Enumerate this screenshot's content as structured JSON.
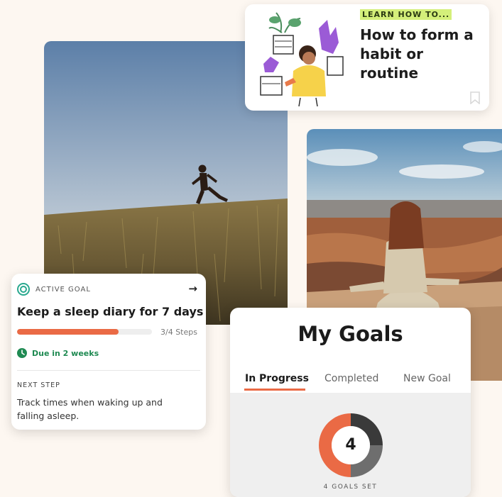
{
  "learn_card": {
    "eyebrow": "LEARN HOW TO...",
    "title": "How to form a habit or routine",
    "icons": [
      "plant-person-illustration",
      "bookmark-icon"
    ]
  },
  "active_goal": {
    "eyebrow": "ACTIVE GOAL",
    "title": "Keep a sleep diary for 7 days",
    "progress_label": "3/4 Steps",
    "progress_fraction": 0.75,
    "due_text": "Due in 2 weeks",
    "next_step_label": "NEXT STEP",
    "next_step_text": "Track times when waking up and falling asleep.",
    "icons": [
      "target-icon",
      "arrow-right-icon",
      "clock-icon"
    ],
    "colors": {
      "accent": "#ea6a45",
      "due": "#1f8a52",
      "target": "#2aa98f"
    }
  },
  "my_goals": {
    "title": "My Goals",
    "tabs": [
      {
        "label": "In Progress",
        "active": true
      },
      {
        "label": "Completed",
        "active": false
      },
      {
        "label": "New Goal",
        "active": false
      }
    ],
    "count": "4",
    "goals_set_label": "4 GOALS SET",
    "donut_segments": [
      {
        "fraction": 0.5,
        "color": "#ea6a45"
      },
      {
        "fraction": 0.25,
        "color": "#3a3a3a"
      },
      {
        "fraction": 0.25,
        "color": "#6e6e6e"
      }
    ]
  },
  "colors": {
    "background": "#fdf7f1",
    "accent": "#ea6a45",
    "highlight": "#d4ef7a"
  }
}
